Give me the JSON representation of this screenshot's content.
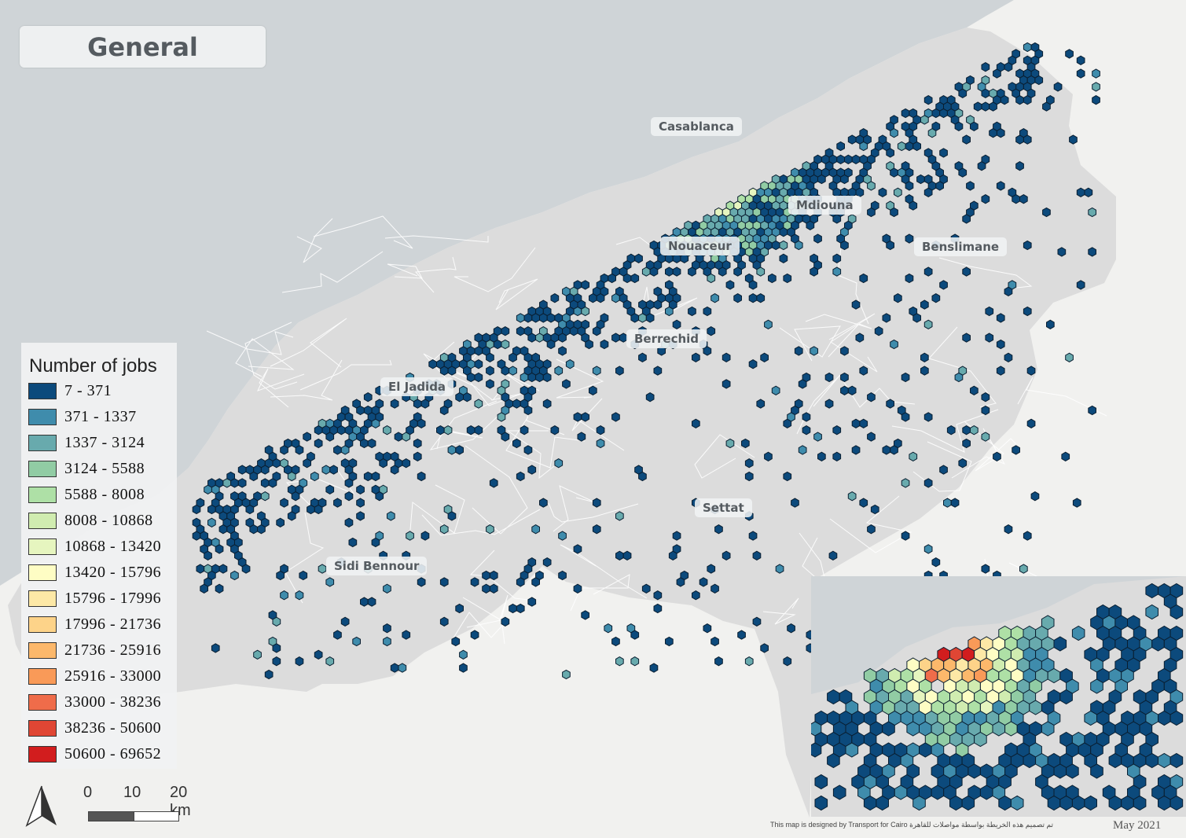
{
  "title": "General",
  "cities": [
    {
      "name": "Casablanca"
    },
    {
      "name": "Mdiouna"
    },
    {
      "name": "Nouaceur"
    },
    {
      "name": "Benslimane"
    },
    {
      "name": "Berrechid"
    },
    {
      "name": "El Jadida"
    },
    {
      "name": "Settat"
    },
    {
      "name": "Sidi Bennour"
    }
  ],
  "legend": {
    "title": "Number of jobs",
    "classes": [
      {
        "label": "7 - 371",
        "color": "#0c4a7c"
      },
      {
        "label": "371 - 1337",
        "color": "#3f8cac"
      },
      {
        "label": "1337 - 3124",
        "color": "#68aaad"
      },
      {
        "label": "3124 - 5588",
        "color": "#91cca4"
      },
      {
        "label": "5588 - 8008",
        "color": "#aee0a6"
      },
      {
        "label": "8008 - 10868",
        "color": "#d0ecb0"
      },
      {
        "label": "10868 - 13420",
        "color": "#e6f5bf"
      },
      {
        "label": "13420 - 15796",
        "color": "#fefdc4"
      },
      {
        "label": "15796 - 17996",
        "color": "#fde8a6"
      },
      {
        "label": "17996 - 21736",
        "color": "#fdd389"
      },
      {
        "label": "21736 - 25916",
        "color": "#fcb86b"
      },
      {
        "label": "25916 - 33000",
        "color": "#f99a58"
      },
      {
        "label": "33000 - 38236",
        "color": "#ef6c4a"
      },
      {
        "label": "38236 - 50600",
        "color": "#e04634"
      },
      {
        "label": "50600 - 69652",
        "color": "#d21d1e"
      }
    ]
  },
  "scale_bar": {
    "labels": [
      "0",
      "10",
      "20 km"
    ]
  },
  "credit": "This map is designed by  Transport for Cairo  تم تصميم هذه الخريطة بواسطة مواصلات للقاهرة",
  "date": "May 2021",
  "colors": {
    "sea": "#cfd4d7",
    "land_outside": "#f1f1ef",
    "region": "#dcdcdc",
    "boundary": "#ffffff"
  }
}
